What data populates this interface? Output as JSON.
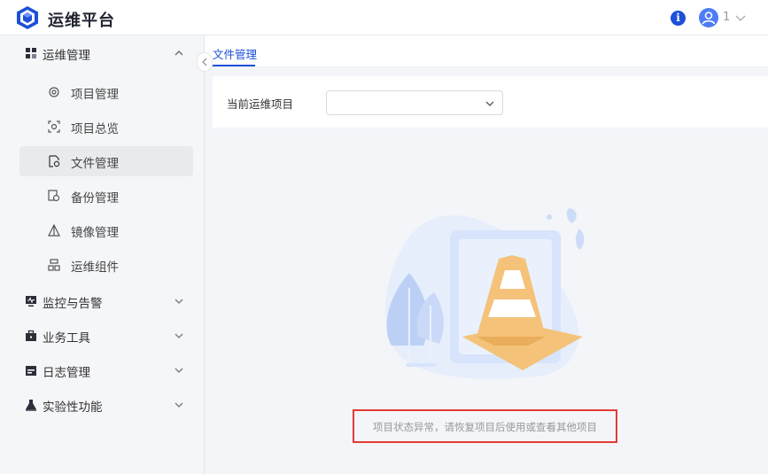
{
  "app": {
    "title": "运维平台"
  },
  "header": {
    "info_icon": "i",
    "user_name": "1"
  },
  "sidebar": {
    "groups": [
      {
        "label": "运维管理",
        "icon": "grid-icon",
        "expanded": true
      },
      {
        "label": "监控与告警",
        "icon": "monitor-icon",
        "expanded": false
      },
      {
        "label": "业务工具",
        "icon": "toolbox-icon",
        "expanded": false
      },
      {
        "label": "日志管理",
        "icon": "calendar-icon",
        "expanded": false
      },
      {
        "label": "实验性功能",
        "icon": "flask-icon",
        "expanded": false
      }
    ],
    "ops_items": [
      {
        "label": "项目管理",
        "icon": "gear-icon"
      },
      {
        "label": "项目总览",
        "icon": "scan-icon"
      },
      {
        "label": "文件管理",
        "icon": "folder-gear-icon",
        "active": true
      },
      {
        "label": "备份管理",
        "icon": "backup-icon"
      },
      {
        "label": "镜像管理",
        "icon": "image-icon"
      },
      {
        "label": "运维组件",
        "icon": "component-icon"
      }
    ]
  },
  "tabs": [
    {
      "label": "文件管理",
      "active": true
    }
  ],
  "filter": {
    "label": "当前运维项目",
    "selected_value": ""
  },
  "empty_state": {
    "message": "项目状态异常，请恢复项目后使用或查看其他项目"
  },
  "colors": {
    "accent": "#1d4fd8",
    "highlight_border": "#e53935",
    "cone_orange": "#f5c27a",
    "illustration_blue": "#d9e5fb"
  }
}
